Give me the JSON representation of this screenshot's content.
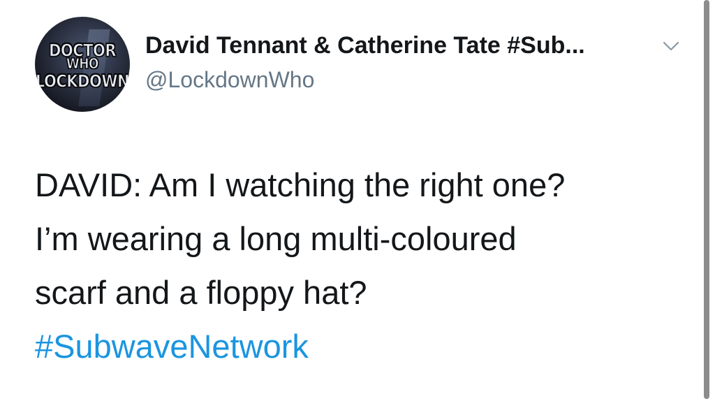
{
  "tweet": {
    "avatar": {
      "logo_line_1": "DOCTOR",
      "logo_line_2": "WHO",
      "logo_line_3": "LOCKDOWN"
    },
    "display_name": "David Tennant & Catherine Tate #Sub...",
    "handle": "@LockdownWho",
    "menu_icon": "chevron-down-icon",
    "body_lines": [
      "DAVID: Am I watching the right one?",
      "I’m wearing a long multi-coloured",
      "scarf and a floppy hat?"
    ],
    "hashtag": "#SubwaveNetwork"
  },
  "colors": {
    "text": "#14171a",
    "secondary": "#657786",
    "link": "#1b95e0"
  }
}
